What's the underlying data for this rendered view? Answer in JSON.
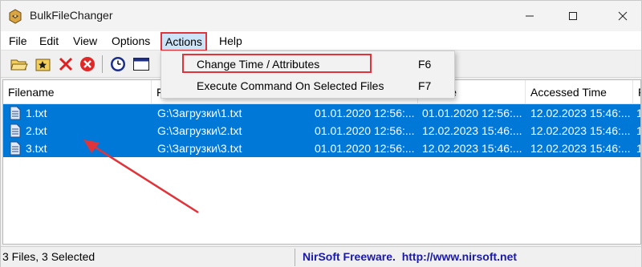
{
  "window": {
    "title": "BulkFileChanger"
  },
  "menu": {
    "file": "File",
    "edit": "Edit",
    "view": "View",
    "options": "Options",
    "actions": "Actions",
    "help": "Help"
  },
  "actions_menu": {
    "items": [
      {
        "label": "Change Time / Attributes",
        "shortcut": "F6"
      },
      {
        "label": "Execute Command On Selected Files",
        "shortcut": "F7"
      }
    ]
  },
  "toolbar": {
    "icons": [
      "open-folder-icon",
      "add-files-icon",
      "remove-icon",
      "stop-icon",
      "clock-icon",
      "window-icon"
    ]
  },
  "list": {
    "columns": [
      "Filename",
      "F",
      "d Time",
      "Accessed Time",
      "F"
    ],
    "rows": [
      {
        "filename": "1.txt",
        "path": "G:\\Загрузки\\1.txt",
        "created": "01.01.2020 12:56:...",
        "modified": "01.01.2020 12:56:...",
        "accessed": "12.02.2023 15:46:...",
        "more": "1"
      },
      {
        "filename": "2.txt",
        "path": "G:\\Загрузки\\2.txt",
        "created": "01.01.2020 12:56:...",
        "modified": "12.02.2023 15:46:...",
        "accessed": "12.02.2023 15:46:...",
        "more": "1"
      },
      {
        "filename": "3.txt",
        "path": "G:\\Загрузки\\3.txt",
        "created": "01.01.2020 12:56:...",
        "modified": "12.02.2023 15:46:...",
        "accessed": "12.02.2023 15:46:...",
        "more": "1"
      }
    ]
  },
  "status": {
    "selection": "3 Files, 3 Selected",
    "credit": "NirSoft Freeware.  http://www.nirsoft.net"
  },
  "colors": {
    "selection": "#0078d7",
    "annotation": "#e0333a",
    "credit": "#1a1aa8"
  }
}
